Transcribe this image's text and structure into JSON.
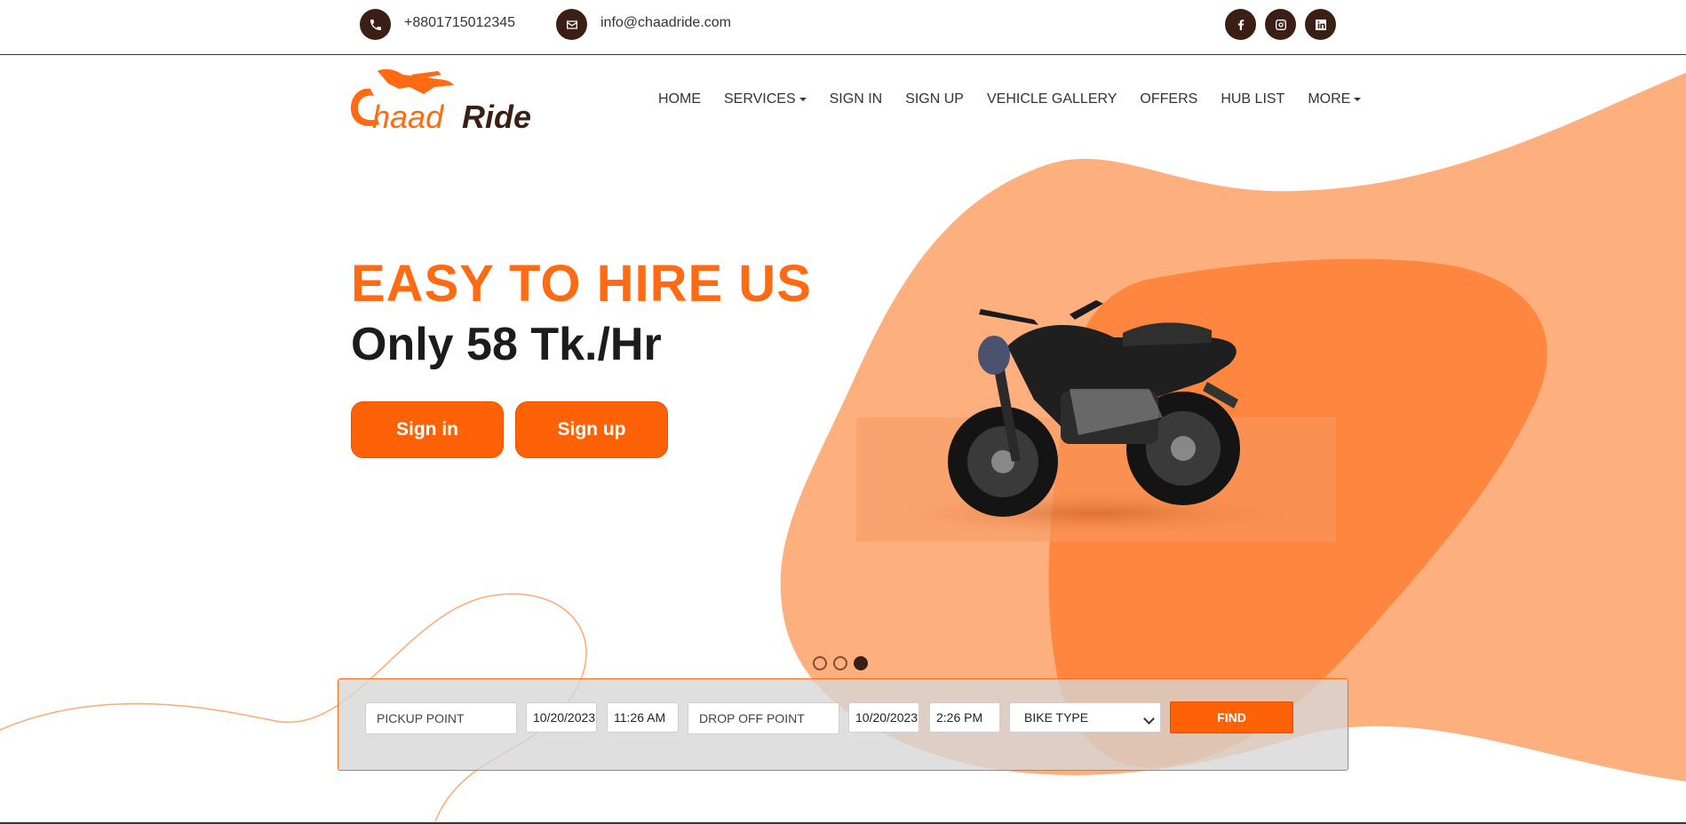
{
  "topbar": {
    "phone": "+8801715012345",
    "email": "info@chaadride.com",
    "social": [
      "facebook-icon",
      "instagram-icon",
      "linkedin-icon"
    ]
  },
  "brand": {
    "logo_text_a": "Chaad",
    "logo_text_b": "Ride",
    "accent": "#ff6a13",
    "dark": "#3b1f14"
  },
  "nav": {
    "items": [
      {
        "label": "HOME",
        "dropdown": false
      },
      {
        "label": "SERVICES",
        "dropdown": true
      },
      {
        "label": "SIGN IN",
        "dropdown": false
      },
      {
        "label": "SIGN UP",
        "dropdown": false
      },
      {
        "label": "VEHICLE GALLERY",
        "dropdown": false
      },
      {
        "label": "OFFERS",
        "dropdown": false
      },
      {
        "label": "HUB LIST",
        "dropdown": false
      },
      {
        "label": "MORE",
        "dropdown": true
      }
    ]
  },
  "hero": {
    "title": "EASY TO HIRE US",
    "subtitle": "Only 58 Tk./Hr",
    "signin_label": "Sign in",
    "signup_label": "Sign up",
    "slides_count": 3,
    "active_slide": 3
  },
  "search": {
    "pickup_placeholder": "PICKUP POINT",
    "pickup_date": "10/20/2023",
    "pickup_time": "11:26 AM",
    "dropoff_placeholder": "DROP OFF POINT",
    "dropoff_date": "10/20/2023",
    "dropoff_time": "2:26 PM",
    "bike_type": "BIKE TYPE",
    "find_label": "FIND"
  }
}
